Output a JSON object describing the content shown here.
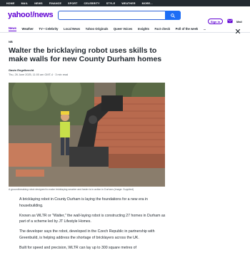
{
  "topbar": {
    "items": [
      "HOME",
      "MAIL",
      "NEWS",
      "FINANCE",
      "SPORT",
      "CELEBRITY",
      "STYLE",
      "WEATHER",
      "MORE..."
    ]
  },
  "header": {
    "logo": "yahoo!",
    "logo_suffix": "/news",
    "signin_label": "Sign in",
    "mail_label": "Mail"
  },
  "nav": {
    "items": [
      "News",
      "Weather",
      "TV • Celebrity",
      "Local News",
      "Yahoo Originals",
      "Queer Voices",
      "Insights",
      "Fact check",
      "Poll of the week",
      "..."
    ]
  },
  "article": {
    "provider": "NB",
    "headline": "Walter the bricklaying robot uses skills to make walls for new County Durham homes",
    "author": "Gavin Engelbrecht",
    "meta": "Thu, 26 June 2025, 11:00 am GMT-4 · 3 min read",
    "caption": "A groundbreaking robot designed to make bricklaying smarter and faster is in action in Durham (Image: Supplied)",
    "paragraphs": [
      "A bricklaying robot in County Durham is laying the foundations for a new era in housebuilding.",
      "Known as WLTR or \"Walter,\" the wall-laying robot is constructing 27 homes in Durham as part of a scheme led by JT Lifestyle Homes.",
      "The developer says the robot, developed in the Czech Republic in partnership with Greenbuild, is helping address the shortage of bricklayers across the UK.",
      "Built for speed and precision, WLTR can lay up to 300 square metres of"
    ]
  },
  "colors": {
    "brand": "#6001d2",
    "search_button": "#1d6df5",
    "topbar": "#232a31"
  }
}
